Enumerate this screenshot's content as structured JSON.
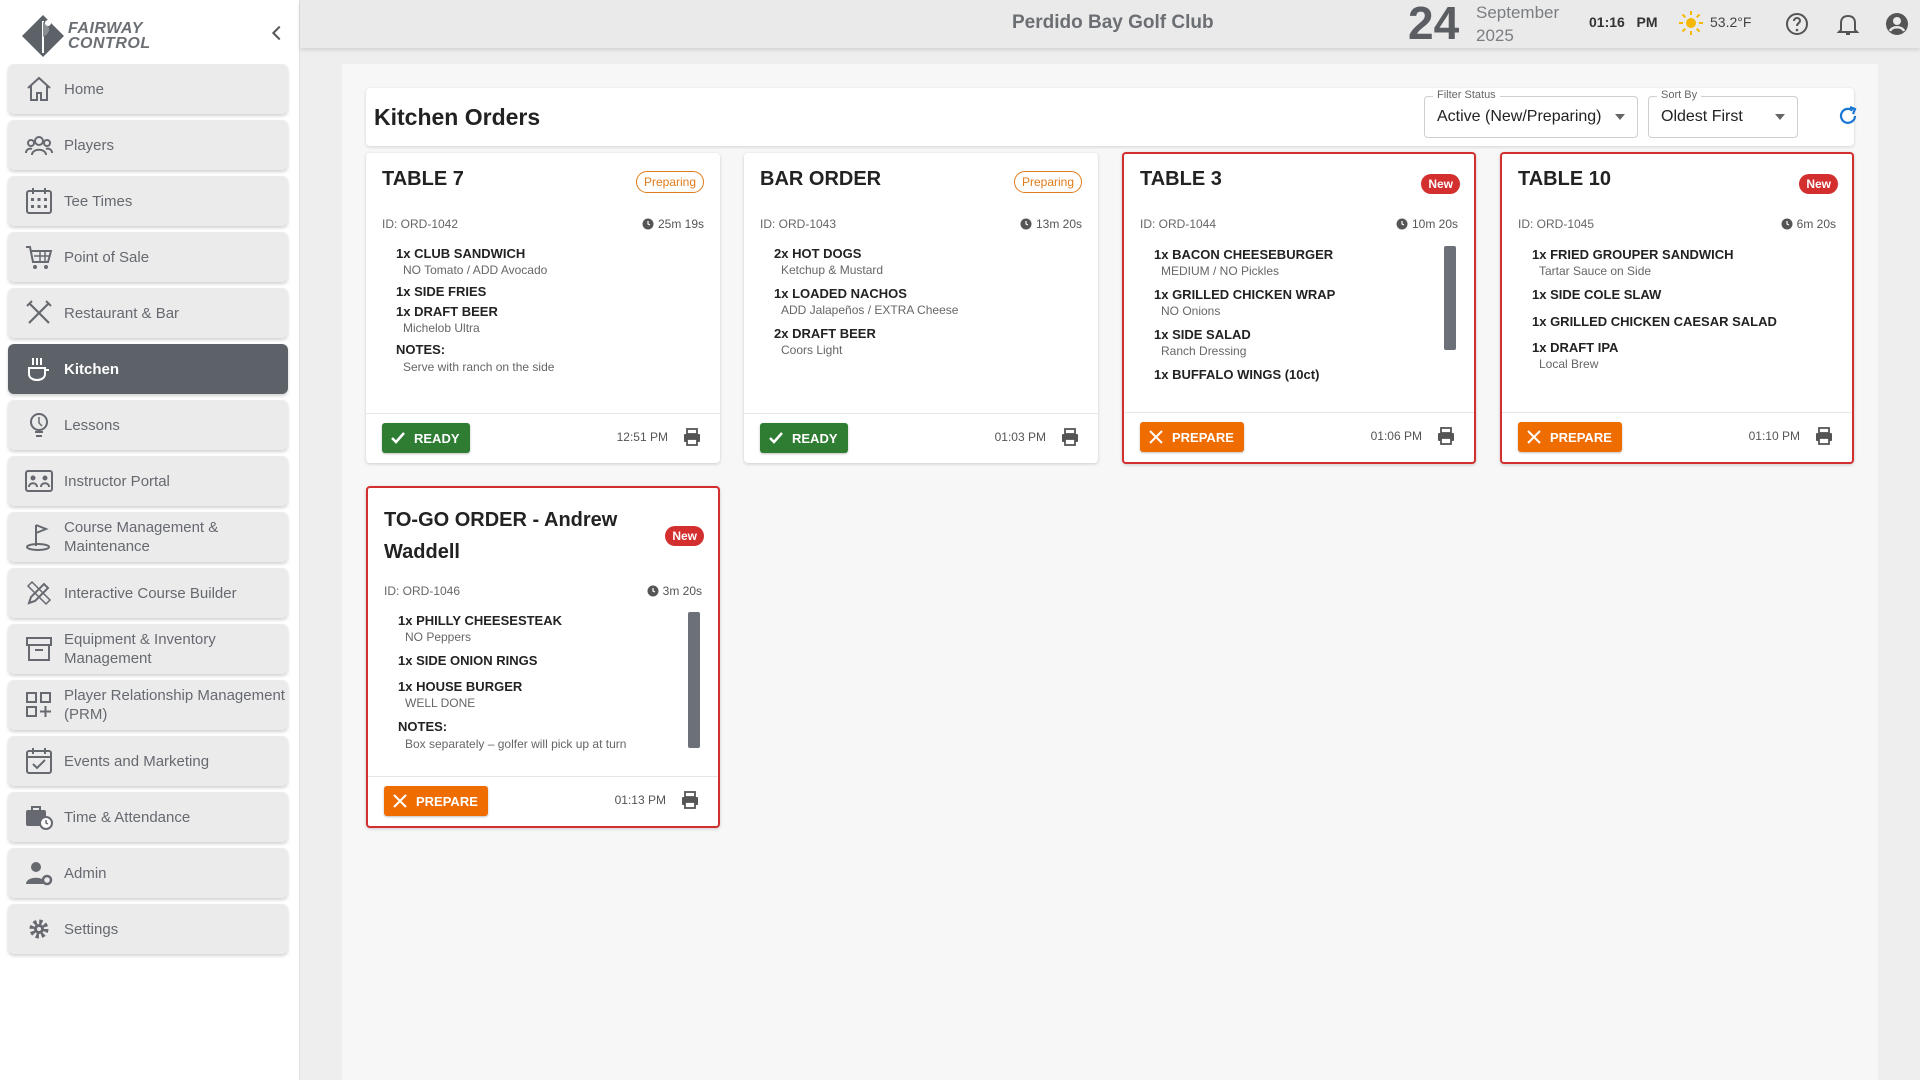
{
  "app": {
    "brand_line1": "FAIRWAY",
    "brand_line2": "CONTROL"
  },
  "sidebar": {
    "items": [
      {
        "label": "Home",
        "icon": "home-icon",
        "active": false
      },
      {
        "label": "Players",
        "icon": "players-icon",
        "active": false
      },
      {
        "label": "Tee Times",
        "icon": "calendar-grid-icon",
        "active": false
      },
      {
        "label": "Point of Sale",
        "icon": "cart-icon",
        "active": false
      },
      {
        "label": "Restaurant & Bar",
        "icon": "utensils-icon",
        "active": false
      },
      {
        "label": "Kitchen",
        "icon": "kitchen-icon",
        "active": true
      },
      {
        "label": "Lessons",
        "icon": "lightbulb-icon",
        "active": false
      },
      {
        "label": "Instructor Portal",
        "icon": "instructor-board-icon",
        "active": false
      },
      {
        "label": "Course Management & Maintenance",
        "icon": "golf-flag-icon",
        "active": false
      },
      {
        "label": "Interactive Course Builder",
        "icon": "pencil-ruler-icon",
        "active": false
      },
      {
        "label": "Equipment & Inventory Management",
        "icon": "archive-box-icon",
        "active": false
      },
      {
        "label": "Player Relationship Management (PRM)",
        "icon": "grid-plus-icon",
        "active": false
      },
      {
        "label": "Events and Marketing",
        "icon": "event-calendar-icon",
        "active": false
      },
      {
        "label": "Time & Attendance",
        "icon": "briefcase-clock-icon",
        "active": false
      },
      {
        "label": "Admin",
        "icon": "admin-user-gear-icon",
        "active": false
      },
      {
        "label": "Settings",
        "icon": "gear-icon",
        "active": false
      }
    ]
  },
  "topbar": {
    "club_name": "Perdido Bay Golf Club",
    "date_day": "24",
    "date_month": "September",
    "date_year": "2025",
    "time": "01:16",
    "ampm": "PM",
    "temperature": "53.2°F",
    "weather_icon": "sun-icon"
  },
  "page": {
    "title": "Kitchen Orders",
    "filter_label": "Filter Status",
    "filter_value": "Active (New/Preparing)",
    "sort_label": "Sort By",
    "sort_value": "Oldest First"
  },
  "colors": {
    "new_border": "#d32f2f",
    "preparing": "#e07b1a",
    "ready_button": "#2e7d32",
    "prepare_button": "#ef6c00",
    "active_nav": "#5d6168"
  },
  "orders": [
    {
      "title": "TABLE 7",
      "status": "Preparing",
      "id": "ID: ORD-1042",
      "elapsed": "25m 19s",
      "items": [
        {
          "name": "1x CLUB SANDWICH",
          "mod": "NO Tomato / ADD Avocado"
        },
        {
          "name": "1x SIDE FRIES"
        },
        {
          "name": "1x DRAFT BEER",
          "mod": "Michelob Ultra"
        }
      ],
      "notes_label": "NOTES:",
      "notes": "Serve with ranch on the side",
      "action": "READY",
      "time": "12:51 PM"
    },
    {
      "title": "BAR ORDER",
      "status": "Preparing",
      "id": "ID: ORD-1043",
      "elapsed": "13m 20s",
      "items": [
        {
          "name": "2x HOT DOGS",
          "mod": "Ketchup & Mustard"
        },
        {
          "name": "1x LOADED NACHOS",
          "mod": "ADD Jalapeños / EXTRA Cheese"
        },
        {
          "name": "2x DRAFT BEER",
          "mod": "Coors Light"
        }
      ],
      "action": "READY",
      "time": "01:03 PM"
    },
    {
      "title": "TABLE 3",
      "status": "New",
      "id": "ID: ORD-1044",
      "elapsed": "10m 20s",
      "items": [
        {
          "name": "1x BACON CHEESEBURGER",
          "mod": "MEDIUM / NO Pickles"
        },
        {
          "name": "1x GRILLED CHICKEN WRAP",
          "mod": "NO Onions"
        },
        {
          "name": "1x SIDE SALAD",
          "mod": "Ranch Dressing"
        },
        {
          "name": "1x BUFFALO WINGS (10ct)"
        }
      ],
      "action": "PREPARE",
      "time": "01:06 PM"
    },
    {
      "title": "TABLE 10",
      "status": "New",
      "id": "ID: ORD-1045",
      "elapsed": "6m 20s",
      "items": [
        {
          "name": "1x FRIED GROUPER SANDWICH",
          "mod": "Tartar Sauce on Side"
        },
        {
          "name": "1x SIDE COLE SLAW"
        },
        {
          "name": "1x GRILLED CHICKEN CAESAR SALAD"
        },
        {
          "name": "1x DRAFT IPA",
          "mod": "Local Brew"
        }
      ],
      "action": "PREPARE",
      "time": "01:10 PM"
    },
    {
      "title_line1": "TO-GO ORDER - Andrew",
      "title_line2": "Waddell",
      "status": "New",
      "id": "ID: ORD-1046",
      "elapsed": "3m 20s",
      "items": [
        {
          "name": "1x PHILLY CHEESESTEAK",
          "mod": "NO Peppers"
        },
        {
          "name": "1x SIDE ONION RINGS"
        },
        {
          "name": "1x HOUSE BURGER",
          "mod": "WELL DONE"
        }
      ],
      "notes_label": "NOTES:",
      "notes": "Box separately – golfer will pick up at turn",
      "action": "PREPARE",
      "time": "01:13 PM"
    }
  ]
}
